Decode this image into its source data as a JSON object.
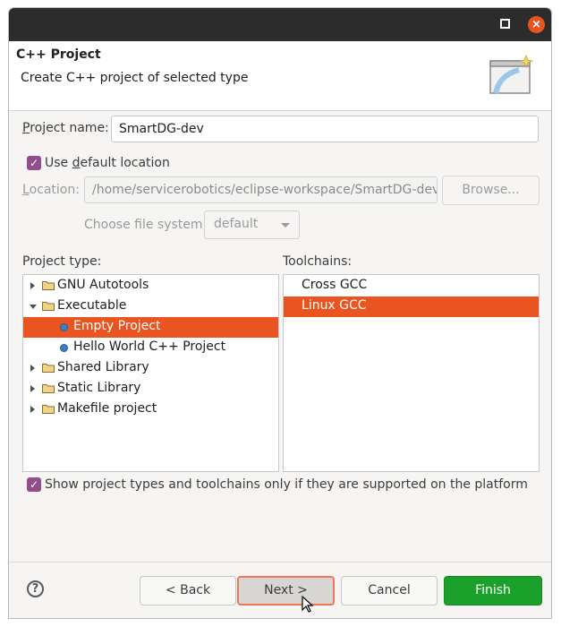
{
  "window": {
    "accent": "#e95420",
    "close_glyph": "×"
  },
  "header": {
    "title": "C++ Project",
    "description": "Create C++ project of selected type"
  },
  "project_name": {
    "label_first": "P",
    "label_rest": "roject name:",
    "value": "SmartDG-dev"
  },
  "use_default_location": {
    "checked": true,
    "label_pre": "Use ",
    "label_u": "d",
    "label_post": "efault location"
  },
  "location": {
    "label_first": "L",
    "label_rest": "ocation:",
    "value": "/home/servicerobotics/eclipse-workspace/SmartDG-dev",
    "browse_label": "Browse..."
  },
  "file_system": {
    "label": "Choose file system:",
    "value": "default"
  },
  "project_type": {
    "label": "Project type:",
    "items": [
      {
        "label": "GNU Autotools",
        "kind": "folder",
        "expanded": false
      },
      {
        "label": "Executable",
        "kind": "folder",
        "expanded": true
      },
      {
        "label": "Empty Project",
        "kind": "project",
        "selected": true
      },
      {
        "label": "Hello World C++ Project",
        "kind": "project"
      },
      {
        "label": "Shared Library",
        "kind": "folder",
        "expanded": false
      },
      {
        "label": "Static Library",
        "kind": "folder",
        "expanded": false
      },
      {
        "label": "Makefile project",
        "kind": "folder",
        "expanded": false
      }
    ]
  },
  "toolchains": {
    "label": "Toolchains:",
    "items": [
      {
        "label": "Cross GCC"
      },
      {
        "label": "Linux GCC",
        "selected": true
      }
    ]
  },
  "show_supported": {
    "checked": true,
    "label": "Show project types and toolchains only if they are supported on the platform"
  },
  "buttons": {
    "help": "?",
    "back": "< Back",
    "next": "Next >",
    "cancel": "Cancel",
    "finish": "Finish"
  },
  "colors": {
    "selection": "#e95420",
    "checkbox": "#924d8b",
    "finish": "#1ba12b"
  }
}
